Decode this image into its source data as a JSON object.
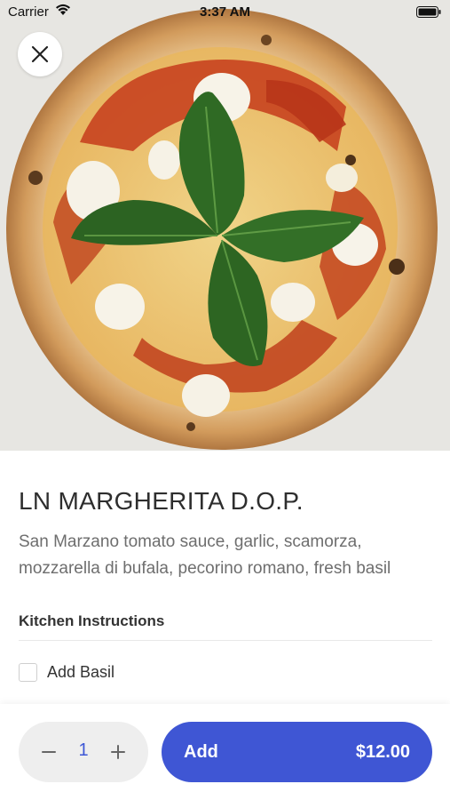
{
  "status_bar": {
    "carrier": "Carrier",
    "time": "3:37 AM"
  },
  "hero": {
    "image_subject": "margherita pizza with basil leaves",
    "close_icon": "close-icon"
  },
  "item": {
    "title": "LN MARGHERITA D.O.P.",
    "description": "San Marzano tomato sauce, garlic, scamorza, mozzarella di bufala, pecorino romano, fresh basil"
  },
  "instructions": {
    "heading": "Kitchen Instructions",
    "options": [
      {
        "label": "Add Basil",
        "checked": false
      }
    ]
  },
  "footer": {
    "quantity": "1",
    "minus_icon": "minus-icon",
    "plus_icon": "plus-icon",
    "add_label": "Add",
    "price": "$12.00"
  },
  "colors": {
    "accent": "#3d57d6",
    "button_bg": "#3f56d4",
    "stepper_bg": "#eeeeee"
  }
}
